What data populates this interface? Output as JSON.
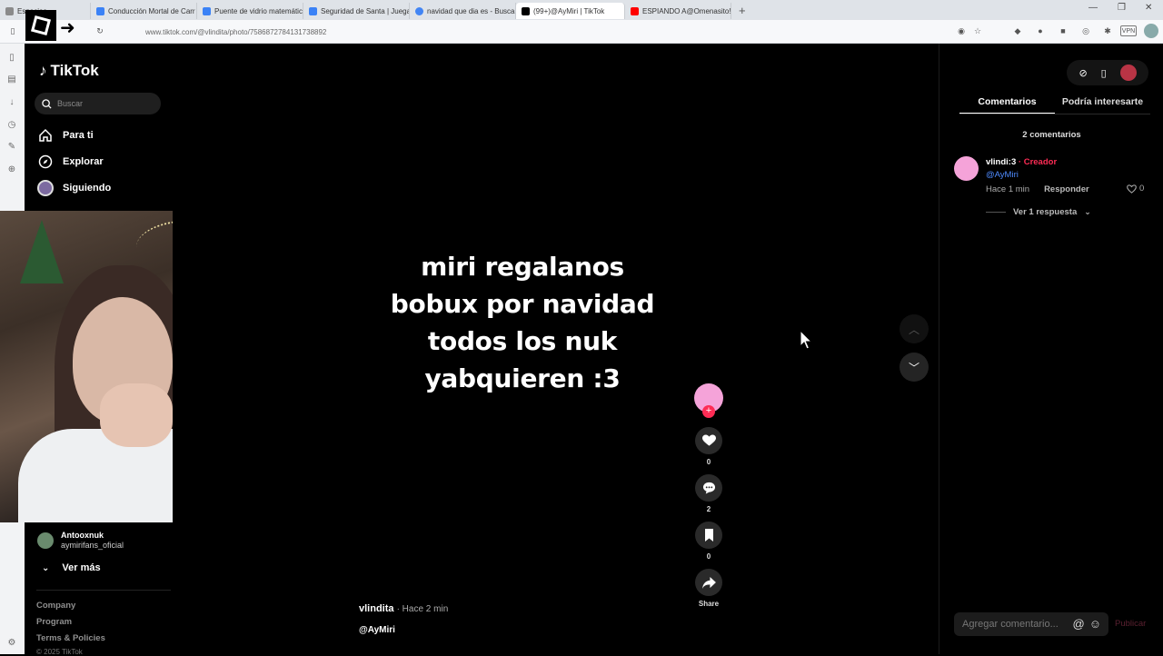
{
  "browser": {
    "tabs": [
      {
        "label": "Espacios",
        "color": "#8a8a8a"
      },
      {
        "label": "Conducción Mortal de Carr",
        "color": "#3b82f6"
      },
      {
        "label": "Puente de vidrio matemátic",
        "color": "#3b82f6"
      },
      {
        "label": "Seguridad de Santa | Juega",
        "color": "#3b82f6"
      },
      {
        "label": "navidad que dia es - Buscar",
        "color": "#4285f4"
      },
      {
        "label": "(99+)@AyMiri | TikTok",
        "color": "#000000"
      },
      {
        "label": "ESPIANDO A@Omenasito!",
        "color": "#ff0000"
      }
    ],
    "url": "www.tiktok.com/@vlindita/photo/7586872784131738892"
  },
  "sidebar": {
    "brand": "TikTok",
    "search_placeholder": "Buscar",
    "nav": [
      {
        "label": "Para ti",
        "icon": "home-icon"
      },
      {
        "label": "Explorar",
        "icon": "compass-icon"
      },
      {
        "label": "Siguiendo",
        "icon": "following-icon"
      }
    ],
    "following_user": {
      "name": "Antooxnuk",
      "handle": "aymirifans_oficial"
    },
    "see_more": "Ver más",
    "footer": [
      "Company",
      "Program",
      "Terms & Policies"
    ],
    "copyright": "© 2025 TikTok"
  },
  "post": {
    "caption": "miri regalanos bobux por navidad todos los nuk yabquieren :3",
    "author": "vlindita",
    "time": "· Hace 2 min",
    "mention": "@AyMiri",
    "counts": {
      "likes": "0",
      "comments": "2",
      "saves": "0",
      "share": "Share"
    }
  },
  "comments_panel": {
    "tabs": [
      "Comentarios",
      "Podría interesarte"
    ],
    "count_text": "2 comentarios",
    "comment": {
      "user": "vlindi:3",
      "creator_tag": " · Creador",
      "text": "@AyMiri",
      "time": "Hace 1 min",
      "reply": "Responder",
      "likes": "0",
      "view_replies": "Ver 1 respuesta"
    },
    "input_placeholder": "Agregar comentario...",
    "post_button": "Publicar"
  },
  "colors": {
    "accent": "#fe2c55",
    "avatar_pink": "#f5a3d9",
    "link_blue": "#4f8bff"
  }
}
